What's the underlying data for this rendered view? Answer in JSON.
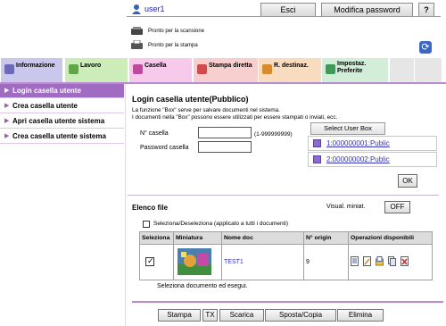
{
  "header": {
    "user_name": "user1",
    "logout_label": "Esci",
    "change_password_label": "Modifica password",
    "help_label": "?",
    "status_scan": "Pronto per la scansione",
    "status_print": "Pronto per la stampa"
  },
  "tabs": [
    {
      "label": "Informazione",
      "color": "#c9c8ec"
    },
    {
      "label": "Lavoro",
      "color": "#ccecba"
    },
    {
      "label": "Casella",
      "color": "#f7c9ea"
    },
    {
      "label": "Stampa diretta",
      "color": "#f8cfcf"
    },
    {
      "label": "R. destinaz.",
      "color": "#f7dcc0"
    },
    {
      "label": "Impostaz. Preferite",
      "color": "#d2eed8"
    }
  ],
  "sidebar": {
    "items": [
      {
        "label": "Login casella utente",
        "active": true
      },
      {
        "label": "Crea casella utente",
        "active": false
      },
      {
        "label": "Apri casella utente sistema",
        "active": false
      },
      {
        "label": "Crea casella utente sistema",
        "active": false
      }
    ]
  },
  "login_form": {
    "title": "Login casella utente(Pubblico)",
    "description_1": "La funzione \"Box\" serve per salvare documenti nel sistema.",
    "description_2": "I documenti nella \"Box\" possono essere utilizzati per essere stampati o inviati, ecc.",
    "box_number_label": "N° casella",
    "box_number_value": "",
    "box_number_range": "(1-999999999)",
    "box_password_label": "Password casella",
    "box_password_value": "",
    "select_box_label": "Select User Box",
    "boxes": [
      "1:000000001:Public",
      "2:000000002:Public"
    ],
    "ok_label": "OK"
  },
  "file_list": {
    "title": "Elenco file",
    "thumbnail_label": "Visual. miniat.",
    "thumbnail_toggle": "OFF",
    "select_all_label": "Seleziona/Deseleziona (applicato a tutti i documenti)",
    "columns": [
      "Seleziona",
      "Miniatura",
      "Nome doc",
      "N° origin",
      "Operazioni disponibili"
    ],
    "rows": [
      {
        "selected": true,
        "name": "TEST1",
        "originals": "9"
      }
    ],
    "hint": "Seleziona documento ed esegui."
  },
  "actions": {
    "print": "Stampa",
    "tx": "TX",
    "download": "Scarica",
    "move_copy": "Sposta/Copia",
    "delete": "Elimina"
  }
}
